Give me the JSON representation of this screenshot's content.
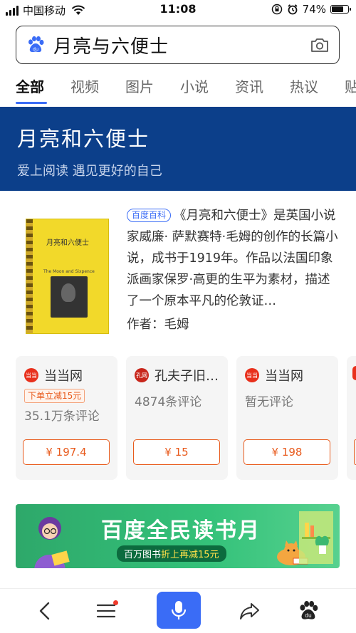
{
  "status_bar": {
    "carrier": "中国移动",
    "time": "11:08",
    "battery": "74%",
    "battery_level": 0.74
  },
  "search": {
    "query": "月亮与六便士"
  },
  "tabs": [
    "全部",
    "视频",
    "图片",
    "小说",
    "资讯",
    "热议",
    "贴"
  ],
  "active_tab": "全部",
  "banner": {
    "title": "月亮和六便士",
    "subtitle": "爱上阅读 遇见更好的自己"
  },
  "book": {
    "cover_title": "月亮和六便士",
    "cover_en": "The Moon and Sixpence",
    "badge": "百度百科",
    "description": "《月亮和六便士》是英国小说家威廉· 萨默赛特·毛姆的创作的长篇小说，成书于1919年。作品以法国印象派画家保罗·高更的生平为素材，描述了一个原本平凡的伦敦证…",
    "author": "作者：毛姆"
  },
  "stores": [
    {
      "name": "当当网",
      "logo": "当当",
      "promo": "下单立减15元",
      "reviews": "35.1万条评论",
      "price": "¥ 197.4"
    },
    {
      "name": "孔夫子旧…",
      "logo": "孔网",
      "promo": "",
      "reviews": "4874条评论",
      "price": "¥ 15"
    },
    {
      "name": "当当网",
      "logo": "当当",
      "promo": "",
      "reviews": "暂无评论",
      "price": "¥ 198"
    }
  ],
  "promo": {
    "title": "百度全民读书月",
    "sub_a": "百万图书",
    "sub_b": "折上再减15元"
  },
  "colors": {
    "accent": "#3a6cf6",
    "banner_bg": "#0c3f8a",
    "price": "#e85a1c",
    "promo_green": "#34c27a"
  },
  "icons": {
    "search": "baidu-paw-icon",
    "camera": "camera-icon",
    "back": "back-arrow-icon",
    "menu": "menu-icon",
    "mic": "microphone-icon",
    "share": "share-icon",
    "home": "baidu-logo-icon"
  }
}
